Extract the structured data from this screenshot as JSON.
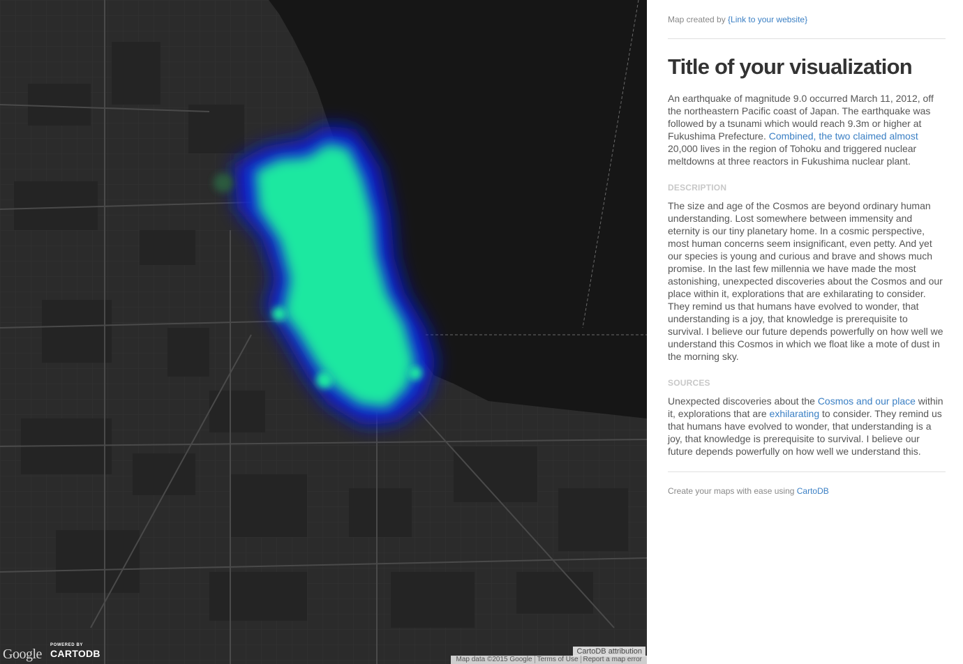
{
  "map": {
    "google_logo": "Google",
    "powered_by": "POWERED BY",
    "brand": "CARTODB",
    "attribution_label": "CartoDB attribution",
    "footer": {
      "map_data": "Map data ©2015 Google",
      "terms": "Terms of Use",
      "report": "Report a map error"
    },
    "colors": {
      "land": "#2b2b2b",
      "water": "#161616",
      "heat_core": "#1ee8a0",
      "heat_edge": "#0a1ad8"
    }
  },
  "panel": {
    "created_prefix": "Map created by ",
    "created_link": "{Link to your website}",
    "title": "Title of your visualization",
    "intro_part1": "An earthquake of magnitude 9.0 occurred March 11, 2012, off the northeastern Pacific coast of Japan. The earthquake was followed by a tsunami which would reach 9.3m or higher at Fukushima Prefecture. ",
    "intro_link": "Combined, the two claimed almost",
    "intro_part2": " 20,000 lives in the region of Tohoku and triggered nuclear meltdowns at three reactors in Fukushima nuclear plant.",
    "description_heading": "DESCRIPTION",
    "description_text": "The size and age of the Cosmos are beyond ordinary human understanding. Lost somewhere between immensity and eternity is our tiny planetary home. In a cosmic perspective, most human concerns seem insignificant, even petty. And yet our species is young and curious and brave and shows much promise. In the last few millennia we have made the most astonishing, unexpected discoveries about the Cosmos and our place within it, explorations that are exhilarating to consider. They remind us that humans have evolved to wonder, that understanding is a joy, that knowledge is prerequisite to survival. I believe our future depends powerfully on how well we understand this Cosmos in which we float like a mote of dust in the morning sky.",
    "sources_heading": "SOURCES",
    "sources_part1": "Unexpected discoveries about the ",
    "sources_link1": "Cosmos and our place",
    "sources_part2": " within it, explorations that are ",
    "sources_link2": "exhilarating",
    "sources_part3": " to consider. They remind us that humans have evolved to wonder, that understanding is a joy, that knowledge is prerequisite to survival. I believe our future depends powerfully on how well we understand this.",
    "footer_prefix": "Create your maps with ease using ",
    "footer_link": "CartoDB"
  }
}
